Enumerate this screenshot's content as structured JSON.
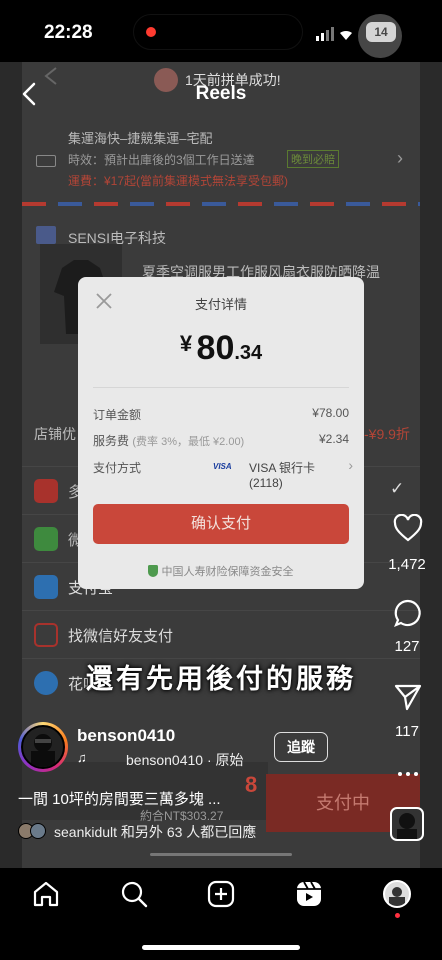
{
  "status_bar": {
    "time": "22:28",
    "battery": "14"
  },
  "header": {
    "title": "Reels"
  },
  "video": {
    "banner": "1天前拼单成功!",
    "shipping": {
      "title": "集運海快‒捷競集運‒宅配",
      "line1_label": "時效：預計出庫後的3個工作日送達",
      "line1_badge": "晚到必賠",
      "line2": "運費：¥17起(當前集運模式無法享受包郵)"
    },
    "shop_name": "SENSI电子科技",
    "product_title": "夏季空调服男工作服风扇衣服防晒降温",
    "shop_discount_label": "店铺优",
    "shop_discount_value": "-¥9.9折",
    "pay_methods": [
      "多多支付",
      "微信支付",
      "支付宝",
      "找微信好友支付",
      "花呗"
    ],
    "pay_price_partial": "8",
    "total_hint": "約合NT$303.27",
    "pay_button_bg": "支付中",
    "subtitle": "還有先用後付的服務"
  },
  "modal": {
    "title": "支付详情",
    "currency": "¥",
    "amount_int": "80",
    "amount_dec": ".34",
    "order_label": "订单金额",
    "order_value": "¥78.00",
    "fee_label": "服务费",
    "fee_note": "(费率 3%，最低 ¥2.00)",
    "fee_value": "¥2.34",
    "method_label": "支付方式",
    "method_badge": "VISA",
    "method_value": "VISA 银行卡 (2118)",
    "confirm_label": "确认支付",
    "security_note": "中国人寿财险保障资金安全"
  },
  "rail": {
    "likes": "1,472",
    "comments": "127",
    "shares": "117"
  },
  "author": {
    "username": "benson0410",
    "follow_label": "追蹤",
    "audio": "benson0410 · 原始",
    "caption": "一間 10坪的房間要三萬多塊 ...",
    "replies": "seankidult 和另外 63 人都已回應"
  },
  "colors": {
    "accent_red": "#c9473a",
    "like_red": "#d8312f",
    "background": "#000000"
  }
}
